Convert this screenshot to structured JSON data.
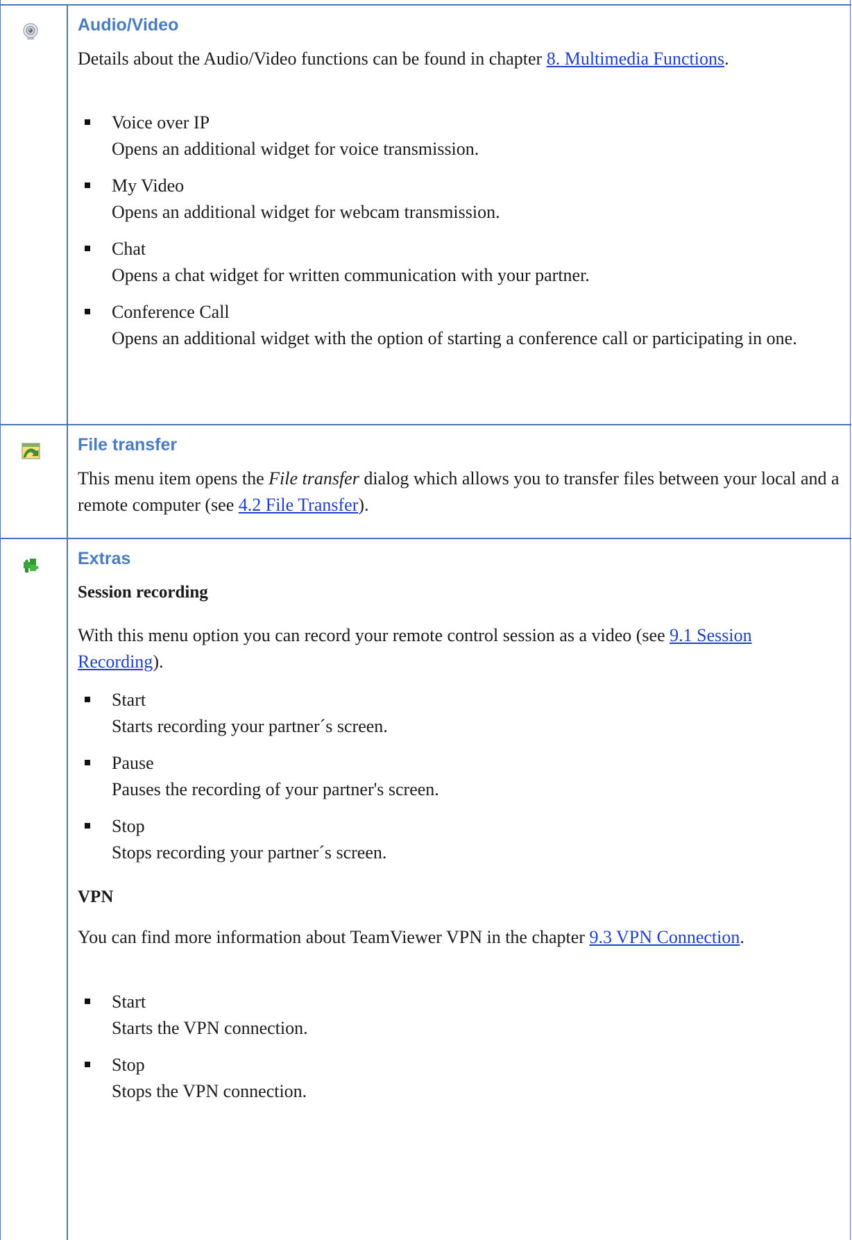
{
  "sections": {
    "audio_video": {
      "title": "Audio/Video",
      "intro_before_link": "Details about the Audio/Video functions can be found in chapter ",
      "intro_link": "8. Multimedia Functions",
      "intro_after_link": ".",
      "items": [
        {
          "label": "Voice over IP",
          "desc": "Opens an additional widget for voice transmission."
        },
        {
          "label": "My Video",
          "desc": "Opens an additional widget for webcam transmission."
        },
        {
          "label": "Chat",
          "desc": "Opens a chat widget for written communication with your partner."
        },
        {
          "label": "Conference Call",
          "desc": "Opens an additional widget with the option of starting a conference call or participating in one."
        }
      ]
    },
    "file_transfer": {
      "title": "File transfer",
      "text_before_italic": "This menu item opens the ",
      "italic": "File transfer",
      "text_after_italic": " dialog which allows you to transfer files between your local and a remote computer (see ",
      "link": "4.2 File Transfer",
      "text_end": ")."
    },
    "extras": {
      "title": "Extras",
      "session_recording": {
        "heading": "Session recording",
        "text_before_link": "With this menu option you can record your remote control session as a video (see ",
        "link": "9.1 Session Recording",
        "text_after_link": ").",
        "items": [
          {
            "label": "Start",
            "desc": "Starts recording your partner´s screen."
          },
          {
            "label": "Pause",
            "desc": "Pauses the recording of your partner's screen."
          },
          {
            "label": "Stop",
            "desc": "Stops recording your partner´s screen."
          }
        ]
      },
      "vpn": {
        "heading": "VPN",
        "text_before_link": "You can find more information about TeamViewer VPN in the chapter ",
        "link": "9.3 VPN Connection",
        "text_after_link": ".",
        "items": [
          {
            "label": "Start",
            "desc": "Starts the VPN connection."
          },
          {
            "label": "Stop",
            "desc": "Stops the VPN connection."
          }
        ]
      }
    }
  },
  "icons": {
    "audio_video": "webcam-icon",
    "file_transfer": "file-transfer-icon",
    "extras": "puzzle-icon"
  },
  "colors": {
    "border": "#4a74b4",
    "heading": "#4a7cc0",
    "link": "#1f3fc4"
  }
}
